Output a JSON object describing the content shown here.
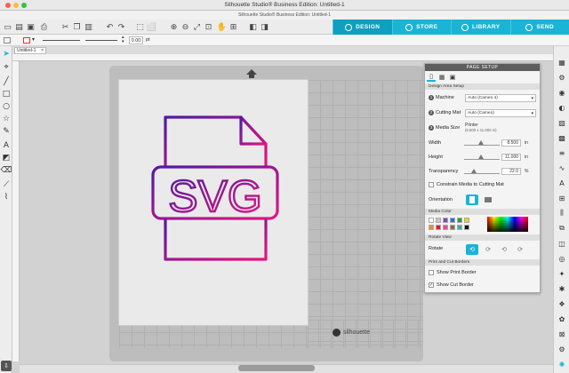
{
  "window": {
    "title": "Silhouette Studio® Business Edition: Untitled-1",
    "subtitle": "Silhouette Studio® Business Edition: Untitled-1"
  },
  "nav": {
    "design": "DESIGN",
    "store": "STORE",
    "library": "LIBRARY",
    "send": "SEND"
  },
  "propbar": {
    "stroke_value": "0.00",
    "stroke_unit": "pt"
  },
  "doc_tab": "Untitled-1",
  "mat": {
    "brand": "silhouette"
  },
  "design": {
    "text": "SVG",
    "gradient_start": "#4f1aa3",
    "gradient_end": "#e6157f"
  },
  "panel": {
    "title": "PAGE SETUP",
    "design_area_setup": "Design Area Setup",
    "machine_label": "Machine",
    "machine_value": "Auto (Cameo 4)",
    "cutting_mat_label": "Cutting Mat",
    "cutting_mat_value": "Auto (Cameo)",
    "media_size_label": "Media Size",
    "media_size_value": "Printer",
    "media_size_dims": "(8.500 x 11.000 in)",
    "width_label": "Width",
    "width_value": "8.500",
    "height_label": "Height",
    "height_value": "11.000",
    "unit_in": "in",
    "transparency_label": "Transparency",
    "transparency_value": "22.0",
    "unit_pct": "%",
    "constrain_label": "Constrain Media to Cutting Mat",
    "orientation_label": "Orientation",
    "media_color_label": "Media Color",
    "rotate_view_label": "Rotate View",
    "rotate_label": "Rotate",
    "print_cut_borders_label": "Print and Cut Borders",
    "show_print_border": "Show Print Border",
    "show_cut_border": "Show Cut Border"
  },
  "colors": {
    "accent": "#1ab4d6",
    "mat": "#bdbdbd"
  }
}
